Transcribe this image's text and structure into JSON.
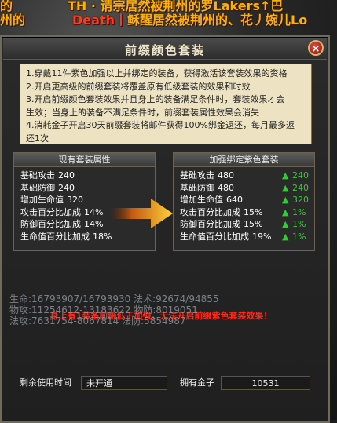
{
  "background": {
    "chat_line_1": "的",
    "chat_line_1b": "TH · 请宗居然被荆州的罗Lakers↑巴",
    "chat_line_2a": "州的",
    "chat_line_2b": "Death丨",
    "chat_line_2c": "稣醒居然被荆州的、花丿婉儿Lo",
    "stats_1": "生命:16793907/16793930   法术:92674/94855",
    "stats_2": "物攻:11254612-13183622   物防:8019051",
    "stats_3": "法攻:7631754-8067814   法防:5854987"
  },
  "dialog": {
    "title": "前缀颜色套装",
    "close_label": "×"
  },
  "rules": [
    "1.穿戴11件紫色加强以上并绑定的装备，获得激活该套装效果的资格",
    "2.开启更高级的前缀套装将覆盖原有低级套装的效果和时效",
    "3.开启前缀颜色套装效果并且身上的装备满足条件时，套装效果才会",
    "生效；当身上的装备不满足条件时，前缀套装属性效果会消失",
    "4.消耗金子开启30天前缀套装将邮件获得100%绑金返还，每月最多返",
    "还1次"
  ],
  "current_panel": {
    "header": "现有套装属性",
    "rows": [
      {
        "label": "基础攻击",
        "value": "240"
      },
      {
        "label": "基础防御",
        "value": "240"
      },
      {
        "label": "增加生命值",
        "value": "320"
      },
      {
        "label": "攻击百分比加成",
        "value": "14%"
      },
      {
        "label": "防御百分比加成",
        "value": "14%"
      },
      {
        "label": "生命值百分比加成",
        "value": "18%"
      }
    ]
  },
  "enhanced_panel": {
    "header": "加强绑定紫色套装",
    "rows": [
      {
        "label": "基础攻击",
        "value": "480",
        "delta": "240"
      },
      {
        "label": "基础防御",
        "value": "480",
        "delta": "240"
      },
      {
        "label": "增加生命值",
        "value": "640",
        "delta": "320"
      },
      {
        "label": "攻击百分比加成",
        "value": "15%",
        "delta": "1%"
      },
      {
        "label": "防御百分比加成",
        "value": "15%",
        "delta": "1%"
      },
      {
        "label": "生命值百分比加成",
        "value": "19%",
        "delta": "1%"
      }
    ]
  },
  "warning": "身上有1装备前缀低于加强，无法开启前缀紫色套装效果！",
  "status": {
    "remaining_label": "剩余使用时间",
    "remaining_value": "未开通",
    "gold_label": "拥有金子",
    "gold_value": "10531"
  },
  "colors": {
    "accent_green": "#33cc33",
    "warning_red": "#ff2a1a",
    "rules_bg": "#ede3c3"
  },
  "icons": {
    "close": "close-icon",
    "arrow": "right-arrow-icon",
    "up": "up-arrow-icon"
  }
}
